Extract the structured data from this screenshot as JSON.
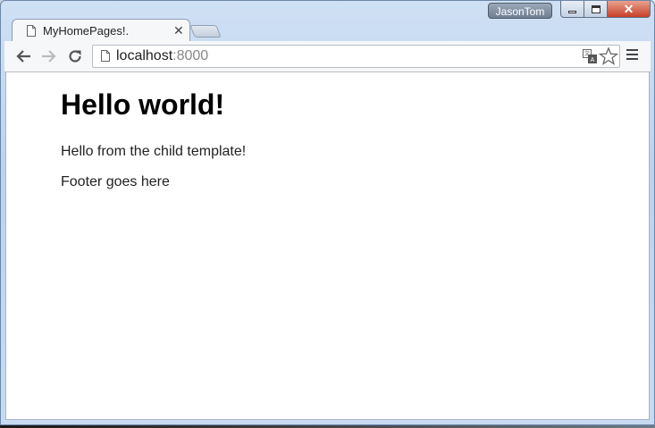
{
  "window": {
    "profile_name": "JasonTom",
    "controls": {
      "minimize": "minimize",
      "maximize": "maximize",
      "close": "✕"
    }
  },
  "tab": {
    "title": "MyHomePages!.",
    "close_label": "✕"
  },
  "toolbar": {
    "url_host": "localhost",
    "url_port": ":8000",
    "icons": [
      "back-arrow-icon",
      "forward-arrow-icon",
      "reload-icon",
      "page-icon",
      "translate-icon",
      "star-icon",
      "menu-icon"
    ]
  },
  "page": {
    "heading": "Hello world!",
    "body_text": "Hello from the child template!",
    "footer_text": "Footer goes here"
  },
  "colors": {
    "window_frame": "#bcd3ee",
    "close_button": "#c7402a",
    "tab_bg": "#f6f7f9",
    "page_bg": "#ffffff"
  }
}
